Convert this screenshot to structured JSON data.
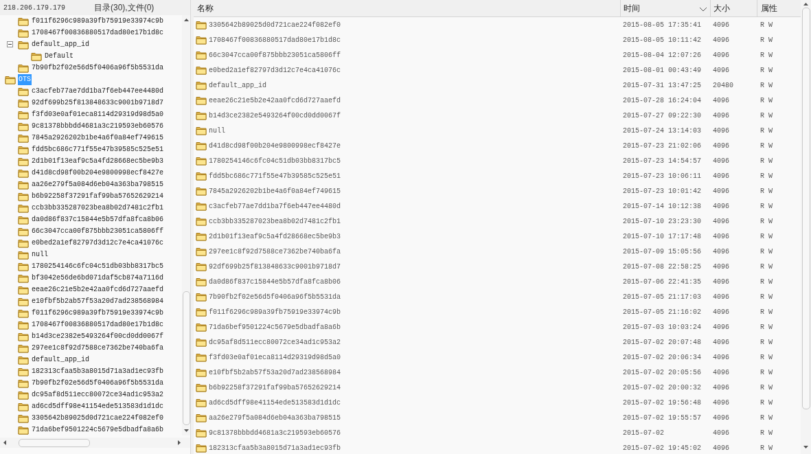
{
  "left_panel": {
    "host": "218.206.179.179",
    "counts": "目录(30),文件(0)",
    "tree": [
      {
        "children": [
          {
            "label": "f011f6296c989a39fb75919e33974c9b",
            "selected": false
          },
          {
            "label": "1708467f00836880517dad80e17b1d8c",
            "selected": false
          },
          {
            "label": "default_app_id",
            "selected": false,
            "expanded": true,
            "children": [
              {
                "label": "Default",
                "selected": false
              }
            ]
          },
          {
            "label": "7b90fb2f02e56d5f0406a96f5b5531da",
            "selected": false
          }
        ]
      },
      {
        "label": "OTS",
        "selected": true,
        "children": [
          {
            "label": "c3acfeb77ae7dd1ba7f6eb447ee4480d",
            "selected": false
          },
          {
            "label": "92df699b25f813848633c9001b9718d7",
            "selected": false
          },
          {
            "label": "f3fd03e0af01eca8114d29319d98d5a0",
            "selected": false
          },
          {
            "label": "9c81378bbbdd4681a3c219593eb60576",
            "selected": false
          },
          {
            "label": "7845a2926202b1be4a6f0a84ef749615",
            "selected": false
          },
          {
            "label": "fdd5bc686c771f55e47b39585c525e51",
            "selected": false
          },
          {
            "label": "2d1b01f13eaf9c5a4fd28668ec5be9b3",
            "selected": false
          },
          {
            "label": "d41d8cd98f00b204e9800998ecf8427e",
            "selected": false
          },
          {
            "label": "aa26e279f5a084d6eb04a363ba798515",
            "selected": false
          },
          {
            "label": "b6b92258f37291faf99ba57652629214",
            "selected": false
          },
          {
            "label": "ccb3bb335287023bea8b02d7481c2fb1",
            "selected": false
          },
          {
            "label": "da0d86f837c15844e5b57dfa8fca8b06",
            "selected": false
          },
          {
            "label": "66c3047cca00f875bbb23051ca5806ff",
            "selected": false
          },
          {
            "label": "e0bed2a1ef82797d3d12c7e4ca41076c",
            "selected": false
          },
          {
            "label": "null",
            "selected": false
          },
          {
            "label": "1780254146c6fc04c51db03bb8317bc5",
            "selected": false
          },
          {
            "label": "bf3042e56de6bd071daf5cb874a7116d",
            "selected": false
          },
          {
            "label": "eeae26c21e5b2e42aa0fcd6d727aaefd",
            "selected": false
          },
          {
            "label": "e10fbf5b2ab57f53a20d7ad238568984",
            "selected": false
          },
          {
            "label": "f011f6296c989a39fb75919e33974c9b",
            "selected": false
          },
          {
            "label": "1708467f00836880517dad80e17b1d8c",
            "selected": false
          },
          {
            "label": "b14d3ce2382e5493264f00cd0dd0067f",
            "selected": false
          },
          {
            "label": "297ee1c8f92d7588ce7362be740ba6fa",
            "selected": false
          },
          {
            "label": "default_app_id",
            "selected": false
          },
          {
            "label": "182313cfaa5b3a8015d71a3ad1ec93fb",
            "selected": false
          },
          {
            "label": "7b90fb2f02e56d5f0406a96f5b5531da",
            "selected": false
          },
          {
            "label": "dc95af8d511ecc80072ce34ad1c953a2",
            "selected": false
          },
          {
            "label": "ad6cd5dff98e41154ede513583d1d1dc",
            "selected": false
          },
          {
            "label": "3305642b89025d0d721cae224f082ef0",
            "selected": false
          },
          {
            "label": "71da6bef9501224c5679e5dbadfa8a6b",
            "selected": false
          }
        ]
      }
    ]
  },
  "table": {
    "columns": [
      {
        "label": "名称"
      },
      {
        "label": "时间",
        "sorted": true
      },
      {
        "label": "大小"
      },
      {
        "label": "属性"
      }
    ],
    "rows": [
      [
        "3305642b89025d0d721cae224f082ef0",
        "2015-08-05 17:35:41",
        "4096",
        "R W"
      ],
      [
        "1708467f00836880517dad80e17b1d8c",
        "2015-08-05 10:11:42",
        "4096",
        "R W"
      ],
      [
        "66c3047cca00f875bbb23051ca5806ff",
        "2015-08-04 12:07:26",
        "4096",
        "R W"
      ],
      [
        "e0bed2a1ef82797d3d12c7e4ca41076c",
        "2015-08-01 00:43:49",
        "4096",
        "R W"
      ],
      [
        "default_app_id",
        "2015-07-31 13:47:25",
        "20480",
        "R W"
      ],
      [
        "eeae26c21e5b2e42aa0fcd6d727aaefd",
        "2015-07-28 16:24:04",
        "4096",
        "R W"
      ],
      [
        "b14d3ce2382e5493264f00cd0dd0067f",
        "2015-07-27 09:22:30",
        "4096",
        "R W"
      ],
      [
        "null",
        "2015-07-24 13:14:03",
        "4096",
        "R W"
      ],
      [
        "d41d8cd98f00b204e9800998ecf8427e",
        "2015-07-23 21:02:06",
        "4096",
        "R W"
      ],
      [
        "1780254146c6fc04c51db03bb8317bc5",
        "2015-07-23 14:54:57",
        "4096",
        "R W"
      ],
      [
        "fdd5bc686c771f55e47b39585c525e51",
        "2015-07-23 10:06:11",
        "4096",
        "R W"
      ],
      [
        "7845a2926202b1be4a6f0a84ef749615",
        "2015-07-23 10:01:42",
        "4096",
        "R W"
      ],
      [
        "c3acfeb77ae7dd1ba7f6eb447ee4480d",
        "2015-07-14 10:12:38",
        "4096",
        "R W"
      ],
      [
        "ccb3bb335287023bea8b02d7481c2fb1",
        "2015-07-10 23:23:30",
        "4096",
        "R W"
      ],
      [
        "2d1b01f13eaf9c5a4fd28668ec5be9b3",
        "2015-07-10 17:17:48",
        "4096",
        "R W"
      ],
      [
        "297ee1c8f92d7588ce7362be740ba6fa",
        "2015-07-09 15:05:56",
        "4096",
        "R W"
      ],
      [
        "92df699b25f813848633c9001b9718d7",
        "2015-07-08 22:58:25",
        "4096",
        "R W"
      ],
      [
        "da0d86f837c15844e5b57dfa8fca8b06",
        "2015-07-06 22:41:35",
        "4096",
        "R W"
      ],
      [
        "7b90fb2f02e56d5f0406a96f5b5531da",
        "2015-07-05 21:17:03",
        "4096",
        "R W"
      ],
      [
        "f011f6296c989a39fb75919e33974c9b",
        "2015-07-05 21:16:02",
        "4096",
        "R W"
      ],
      [
        "71da6bef9501224c5679e5dbadfa8a6b",
        "2015-07-03 10:03:24",
        "4096",
        "R W"
      ],
      [
        "dc95af8d511ecc80072ce34ad1c953a2",
        "2015-07-02 20:07:48",
        "4096",
        "R W"
      ],
      [
        "f3fd03e0af01eca8114d29319d98d5a0",
        "2015-07-02 20:06:34",
        "4096",
        "R W"
      ],
      [
        "e10fbf5b2ab57f53a20d7ad238568984",
        "2015-07-02 20:05:56",
        "4096",
        "R W"
      ],
      [
        "b6b92258f37291faf99ba57652629214",
        "2015-07-02 20:00:32",
        "4096",
        "R W"
      ],
      [
        "ad6cd5dff98e41154ede513583d1d1dc",
        "2015-07-02 19:56:48",
        "4096",
        "R W"
      ],
      [
        "aa26e279f5a084d6eb04a363ba798515",
        "2015-07-02 19:55:57",
        "4096",
        "R W"
      ],
      [
        "9c81378bbbdd4681a3c219593eb60576",
        "2015-07-02",
        "4096",
        "R W"
      ],
      [
        "182313cfaa5b3a8015d71a3ad1ec93fb",
        "2015-07-02 19:45:02",
        "4096",
        "R W"
      ]
    ]
  }
}
